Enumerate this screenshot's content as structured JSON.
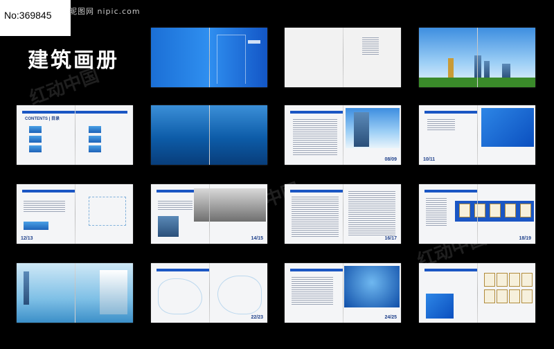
{
  "image_id_label": "No:369845",
  "site_label": "昵图网 nipic.com",
  "title": "建筑画册",
  "watermark": "红动中国",
  "contents_label": "CONTENTS | 目录",
  "page_numbers": [
    "08/09",
    "10/11",
    "12/13",
    "14/15",
    "16/17",
    "18/19",
    "22/23",
    "24/25"
  ],
  "colors": {
    "brand_blue": "#1a56c4",
    "background": "#000000"
  }
}
